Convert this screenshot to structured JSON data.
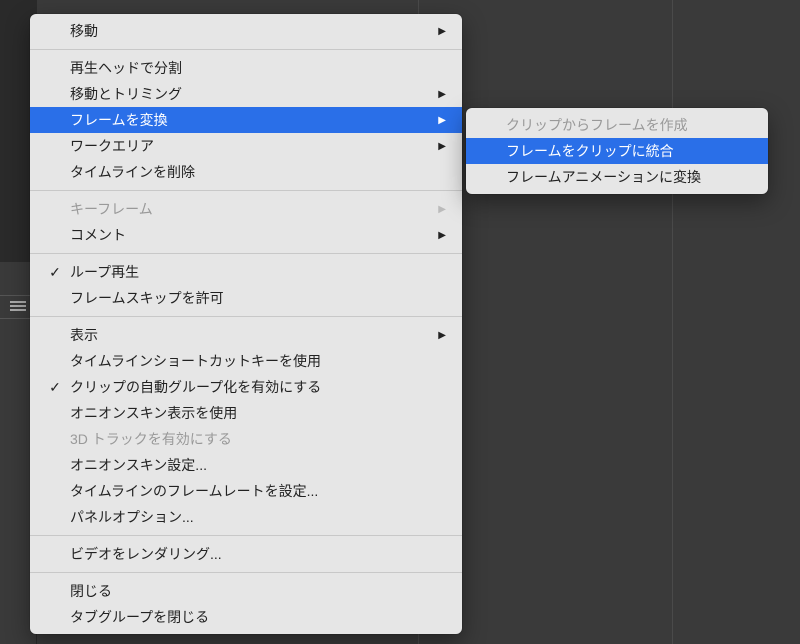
{
  "mainMenu": {
    "items": [
      {
        "label": "移動",
        "hasSubmenu": true,
        "enabled": true,
        "checked": false
      },
      {
        "separator": true
      },
      {
        "label": "再生ヘッドで分割",
        "hasSubmenu": false,
        "enabled": true,
        "checked": false
      },
      {
        "label": "移動とトリミング",
        "hasSubmenu": true,
        "enabled": true,
        "checked": false
      },
      {
        "label": "フレームを変換",
        "hasSubmenu": true,
        "enabled": true,
        "checked": false,
        "selected": true
      },
      {
        "label": "ワークエリア",
        "hasSubmenu": true,
        "enabled": true,
        "checked": false
      },
      {
        "label": "タイムラインを削除",
        "hasSubmenu": false,
        "enabled": true,
        "checked": false
      },
      {
        "separator": true
      },
      {
        "label": "キーフレーム",
        "hasSubmenu": true,
        "enabled": false,
        "checked": false
      },
      {
        "label": "コメント",
        "hasSubmenu": true,
        "enabled": true,
        "checked": false
      },
      {
        "separator": true
      },
      {
        "label": "ループ再生",
        "hasSubmenu": false,
        "enabled": true,
        "checked": true
      },
      {
        "label": "フレームスキップを許可",
        "hasSubmenu": false,
        "enabled": true,
        "checked": false
      },
      {
        "separator": true
      },
      {
        "label": "表示",
        "hasSubmenu": true,
        "enabled": true,
        "checked": false
      },
      {
        "label": "タイムラインショートカットキーを使用",
        "hasSubmenu": false,
        "enabled": true,
        "checked": false
      },
      {
        "label": "クリップの自動グループ化を有効にする",
        "hasSubmenu": false,
        "enabled": true,
        "checked": true
      },
      {
        "label": "オニオンスキン表示を使用",
        "hasSubmenu": false,
        "enabled": true,
        "checked": false
      },
      {
        "label": "3D トラックを有効にする",
        "hasSubmenu": false,
        "enabled": false,
        "checked": false
      },
      {
        "label": "オニオンスキン設定...",
        "hasSubmenu": false,
        "enabled": true,
        "checked": false
      },
      {
        "label": "タイムラインのフレームレートを設定...",
        "hasSubmenu": false,
        "enabled": true,
        "checked": false
      },
      {
        "label": "パネルオプション...",
        "hasSubmenu": false,
        "enabled": true,
        "checked": false
      },
      {
        "separator": true
      },
      {
        "label": "ビデオをレンダリング...",
        "hasSubmenu": false,
        "enabled": true,
        "checked": false
      },
      {
        "separator": true
      },
      {
        "label": "閉じる",
        "hasSubmenu": false,
        "enabled": true,
        "checked": false
      },
      {
        "label": "タブグループを閉じる",
        "hasSubmenu": false,
        "enabled": true,
        "checked": false
      }
    ]
  },
  "subMenu": {
    "items": [
      {
        "label": "クリップからフレームを作成",
        "enabled": false,
        "selected": false
      },
      {
        "label": "フレームをクリップに統合",
        "enabled": true,
        "selected": true
      },
      {
        "label": "フレームアニメーションに変換",
        "enabled": true,
        "selected": false
      }
    ]
  },
  "glyphs": {
    "check": "✓",
    "arrow": "▶"
  }
}
